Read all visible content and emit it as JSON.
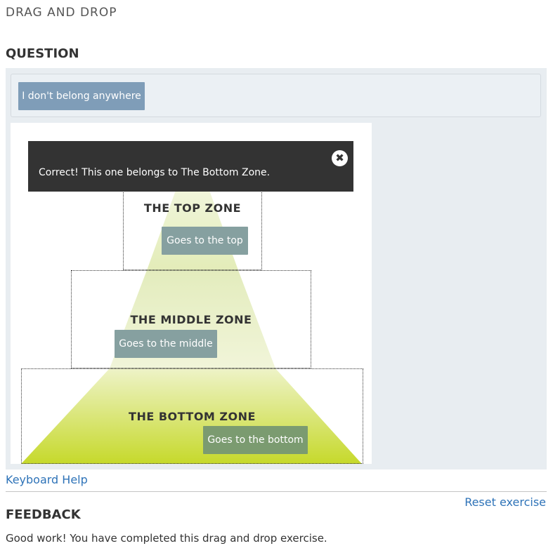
{
  "header": {
    "title": "DRAG AND DROP"
  },
  "question": {
    "title": "QUESTION",
    "item_bank": {
      "unplaced_item": "I don't belong anywhere"
    },
    "popup": {
      "message": "Correct! This one belongs to The Bottom Zone.",
      "close_icon": "close-circle-icon",
      "close_glyph": "✖"
    },
    "zones": [
      {
        "label": "THE TOP ZONE",
        "item": "Goes to the top"
      },
      {
        "label": "THE MIDDLE ZONE",
        "item": "Goes to the middle"
      },
      {
        "label": "THE BOTTOM ZONE",
        "item": "Goes to the bottom"
      }
    ],
    "colors": {
      "pyramid_top": "#f2f7e4",
      "pyramid_bottom": "#c7d92a",
      "popup_bg": "#333333",
      "tile_unplaced": "#7f9db8",
      "tile_placed": "#86a0a0",
      "tile_correct": "#7b9b70",
      "link": "#2e73b8"
    }
  },
  "footer": {
    "keyboard_help": "Keyboard Help",
    "reset": "Reset exercise"
  },
  "feedback": {
    "title": "FEEDBACK",
    "message": "Good work! You have completed this drag and drop exercise."
  }
}
